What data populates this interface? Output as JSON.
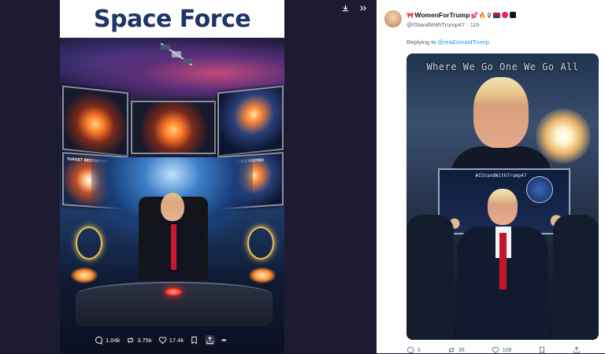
{
  "viewer": {
    "banner_title": "Space Force",
    "screen_labels": [
      "TARGET DESTROYED",
      "TARGET DESTROYED"
    ],
    "actions": [
      {
        "icon": "reply-icon",
        "count": "1.04k"
      },
      {
        "icon": "retweet-icon",
        "count": "3.75k"
      },
      {
        "icon": "like-icon",
        "count": "17.4k"
      },
      {
        "icon": "bookmark-icon",
        "count": ""
      },
      {
        "icon": "share-icon",
        "count": ""
      },
      {
        "icon": "more-icon",
        "count": "•••"
      }
    ],
    "top_buttons": [
      "download-icon",
      "expand-icon"
    ]
  },
  "tweet": {
    "display_name": "WomenForTrump",
    "name_emojis": [
      "🎀",
      "💕",
      "🔥",
      "♀"
    ],
    "handle": "@IStandWithTrump47",
    "time": "11h",
    "reply_prefix": "Replying to",
    "reply_to": "@realDonaldTrump",
    "image_caption": "Where We Go One We Go All",
    "image_panel_text": "#IStandWithTrump47",
    "actions": [
      {
        "icon": "reply-icon",
        "count": "5"
      },
      {
        "icon": "retweet-icon",
        "count": "36"
      },
      {
        "icon": "like-icon",
        "count": "108"
      },
      {
        "icon": "bookmark-icon",
        "count": ""
      },
      {
        "icon": "share-icon",
        "count": ""
      }
    ]
  },
  "colors": {
    "viewer_bg": "#1c1b31",
    "banner_text": "#1e3566",
    "link": "#1d9bf0",
    "muted_text": "#536471"
  }
}
